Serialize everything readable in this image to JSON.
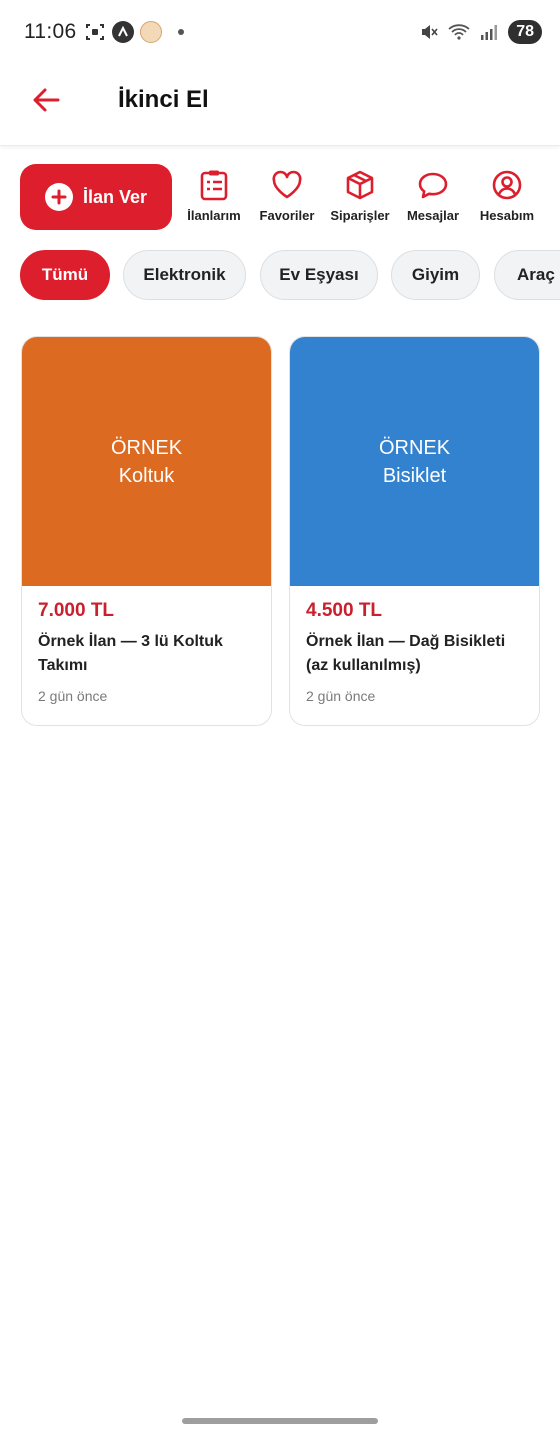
{
  "status_bar": {
    "time": "11:06",
    "battery": "78"
  },
  "header": {
    "title": "İkinci El"
  },
  "colors": {
    "accent": "#dc1e2d",
    "card1_bg": "#dc6a21",
    "card2_bg": "#3282d0"
  },
  "quick_actions": {
    "ilan_ver_label": "İlan Ver",
    "items": [
      {
        "label": "İlanlarım",
        "icon": "clipboard-list-icon"
      },
      {
        "label": "Favoriler",
        "icon": "heart-icon"
      },
      {
        "label": "Siparişler",
        "icon": "box-icon"
      },
      {
        "label": "Mesajlar",
        "icon": "chat-bubble-icon"
      },
      {
        "label": "Hesabım",
        "icon": "user-circle-icon"
      }
    ]
  },
  "categories": [
    {
      "label": "Tümü",
      "active": true
    },
    {
      "label": "Elektronik",
      "active": false
    },
    {
      "label": "Ev Eşyası",
      "active": false
    },
    {
      "label": "Giyim",
      "active": false
    },
    {
      "label": "Araç &",
      "active": false
    }
  ],
  "listings": [
    {
      "image_line1": "ÖRNEK",
      "image_line2": "Koltuk",
      "price": "7.000 TL",
      "title": "Örnek İlan — 3 lü Koltuk Takımı",
      "time": "2 gün önce"
    },
    {
      "image_line1": "ÖRNEK",
      "image_line2": "Bisiklet",
      "price": "4.500 TL",
      "title": "Örnek İlan — Dağ Bisikleti (az kullanılmış)",
      "time": "2 gün önce"
    }
  ]
}
